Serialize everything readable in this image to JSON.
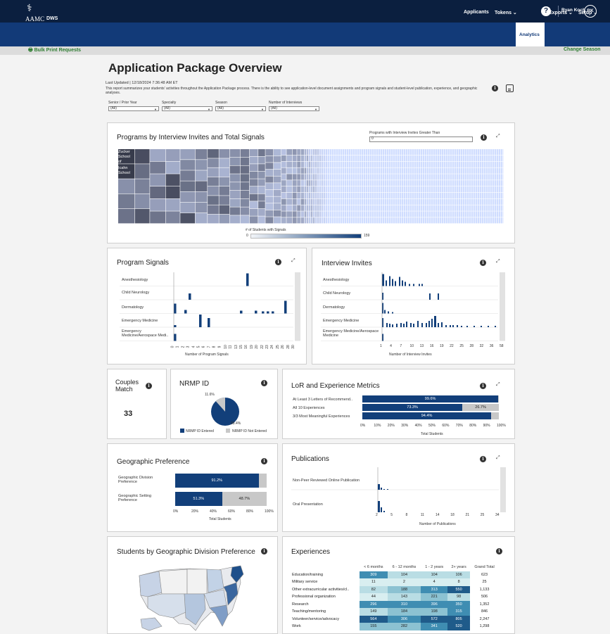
{
  "header": {
    "help": "?",
    "user_name": "Ryan Koch",
    "user_initials": "RK",
    "logo": {
      "brand": "AAMC",
      "product": "DWS"
    },
    "nav": [
      "Applicants",
      "Tokens ⌄",
      "Analytics",
      "Exports ⌄",
      "Setup ⌄"
    ],
    "active_nav": "Analytics",
    "bulk_print": "Bulk Print Requests",
    "change_season": "Change Season"
  },
  "page": {
    "title": "Application Package Overview",
    "last_updated": "Last Updated | 12/18/2024 7:36:48 AM ET",
    "description": "This report summarizes your students' activities throughout the Application Package process. There is the ability to see application-level document assignments and program signals and student-level publication, experience, and geographic analyses."
  },
  "filters": [
    {
      "label": "Senior / Prior Year",
      "value": "(All)"
    },
    {
      "label": "Specialty",
      "value": "(All)"
    },
    {
      "label": "Season",
      "value": "(All)"
    },
    {
      "label": "Number of Interviews",
      "value": "(All)"
    }
  ],
  "programs_panel": {
    "title": "Programs by Interview Invites and Total Signals",
    "filter_label": "Programs with Interview Invites Greater Than",
    "filter_value": "0",
    "tile_labels": [
      "Zucker School of",
      "Icahn School"
    ],
    "legend_title": "# of Students with Signals",
    "legend_min": "0",
    "legend_max": "159"
  },
  "program_signals": {
    "title": "Program Signals",
    "categories": [
      "Anesthesiology",
      "Child Neurology",
      "Dermatology",
      "Emergency Medicine",
      "Emergency Medicine/Aerospace Medi.."
    ],
    "x_ticks": [
      "0",
      "1",
      "2",
      "3",
      "4",
      "5",
      "6",
      "7",
      "8",
      "9",
      "10",
      "11",
      "13",
      "15",
      "16",
      "19",
      "20",
      "22",
      "23",
      "24",
      "25",
      "26",
      "28",
      "30"
    ],
    "xlabel": "Number of Program Signals"
  },
  "interview_invites": {
    "title": "Interview Invites",
    "categories": [
      "Anesthesiology",
      "Child Neurology",
      "Dermatology",
      "Emergency Medicine",
      "Emergency Medicine/Aerospace Medicine"
    ],
    "x_ticks": [
      "1",
      "4",
      "7",
      "10",
      "13",
      "16",
      "19",
      "22",
      "25",
      "28",
      "32",
      "36",
      "58"
    ],
    "xlabel": "Number of Interview Invites"
  },
  "couples_match": {
    "title": "Couples Match",
    "value": "33"
  },
  "nrmp": {
    "title": "NRMP ID",
    "entered_pct": "88.4%",
    "not_entered_pct": "11.6%",
    "legend": [
      "NRMP ID Entered",
      "NRMP ID Not Entered"
    ],
    "colors": {
      "entered": "#123f7a",
      "not_entered": "#c8c8c8"
    }
  },
  "lor": {
    "title": "LoR and Experience Metrics",
    "rows": [
      {
        "label": "At Least 3 Letters of Recommend..",
        "yes": 99.6,
        "yes_label": "99.6%",
        "no_label": ""
      },
      {
        "label": "All 10 Experiences",
        "yes": 73.3,
        "yes_label": "73.3%",
        "no_label": "26.7%"
      },
      {
        "label": "3/3 Most Meaningful Experiences",
        "yes": 94.4,
        "yes_label": "94.4%",
        "no_label": ""
      }
    ],
    "x_ticks": [
      "0%",
      "10%",
      "20%",
      "30%",
      "40%",
      "50%",
      "60%",
      "70%",
      "80%",
      "90%",
      "100%"
    ],
    "xlabel": "Total Students"
  },
  "geo_pref": {
    "title": "Geographic Preference",
    "rows": [
      {
        "label": "Geographic Division Preference",
        "yes": 91.2,
        "yes_label": "91.2%",
        "no_label": ""
      },
      {
        "label": "Geographic Setting Preference",
        "yes": 51.3,
        "yes_label": "51.3%",
        "no_label": "48.7%"
      }
    ],
    "x_ticks": [
      "0%",
      "20%",
      "40%",
      "60%",
      "80%",
      "100%"
    ],
    "xlabel": "Total Students"
  },
  "publications": {
    "title": "Publications",
    "categories": [
      "Non-Peer Reviewed Online Publication",
      "Oral Presentation"
    ],
    "x_ticks": [
      "2",
      "5",
      "8",
      "11",
      "14",
      "18",
      "21",
      "25",
      "34"
    ],
    "xlabel": "Number of Publications"
  },
  "geo_division": {
    "title": "Students by Geographic Division Preference"
  },
  "experiences": {
    "title": "Experiences",
    "columns": [
      "< 6 months",
      "6 - 12 months",
      "1 - 2 years",
      "2+ years",
      "Grand Total"
    ],
    "rows": [
      {
        "label": "Education/training",
        "values": [
          "309",
          "104",
          "104",
          "106"
        ],
        "total": "623"
      },
      {
        "label": "Military service",
        "values": [
          "11",
          "2",
          "4",
          "8"
        ],
        "total": "25"
      },
      {
        "label": "Other extracurricular activities/cl..",
        "values": [
          "82",
          "188",
          "313",
          "550"
        ],
        "total": "1,133"
      },
      {
        "label": "Professional organization",
        "values": [
          "44",
          "143",
          "221",
          "98"
        ],
        "total": "506"
      },
      {
        "label": "Research",
        "values": [
          "296",
          "310",
          "396",
          "350"
        ],
        "total": "1,352"
      },
      {
        "label": "Teaching/mentoring",
        "values": [
          "149",
          "184",
          "198",
          "315"
        ],
        "total": "846"
      },
      {
        "label": "Volunteer/service/advocacy",
        "values": [
          "564",
          "306",
          "572",
          "805"
        ],
        "total": "2,247"
      },
      {
        "label": "Work",
        "values": [
          "155",
          "282",
          "341",
          "520"
        ],
        "total": "1,298"
      }
    ]
  },
  "colors": {
    "navy": "#0b1f3f",
    "brand": "#123a78",
    "bar": "#123f7a",
    "green": "#2f7d32",
    "gray": "#c8c8c8"
  }
}
